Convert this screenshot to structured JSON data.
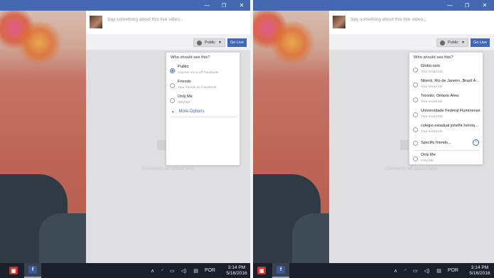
{
  "composer": {
    "placeholder": "Say something about this live video..."
  },
  "controls": {
    "privacy_label": "Public",
    "go_live_label": "Go Live"
  },
  "empty_state": {
    "text": "Comments will appear here"
  },
  "left_dropdown": {
    "header": "Who should see this?",
    "options": [
      {
        "title": "Public",
        "subtitle": "Anyone on or off Facebook",
        "selected": true
      },
      {
        "title": "Friends",
        "subtitle": "Your friends on Facebook",
        "selected": false
      },
      {
        "title": "Only Me",
        "subtitle": "Only Me",
        "selected": false
      }
    ],
    "more_options": "More Options"
  },
  "right_dropdown": {
    "header": "Who should see this?",
    "options": [
      {
        "title": "Globo.com",
        "subtitle": "Your smart list"
      },
      {
        "title": "Niterói, Rio de Janeiro, Brazil Area",
        "subtitle": "Your smart list"
      },
      {
        "title": "Toronto, Ontario Area",
        "subtitle": "Your smart list"
      },
      {
        "title": "Universidade Federal Fluminense",
        "subtitle": "Your smart list"
      },
      {
        "title": "colegio estadual joheñir henrique...",
        "subtitle": "Your smart list"
      }
    ],
    "specific_friends": "Specific friends...",
    "only_me": {
      "title": "Only Me",
      "subtitle": "Only Me"
    }
  },
  "taskbar": {
    "language": "POR",
    "time": "3:14 PM",
    "date": "5/16/2016",
    "apps": [
      "camera-app",
      "facebook-app"
    ]
  },
  "window_controls": {
    "minimize": "—",
    "maximize": "❐",
    "close": "✕"
  },
  "colors": {
    "accent": "#4469b2",
    "taskbar": "#1a1f2b"
  }
}
